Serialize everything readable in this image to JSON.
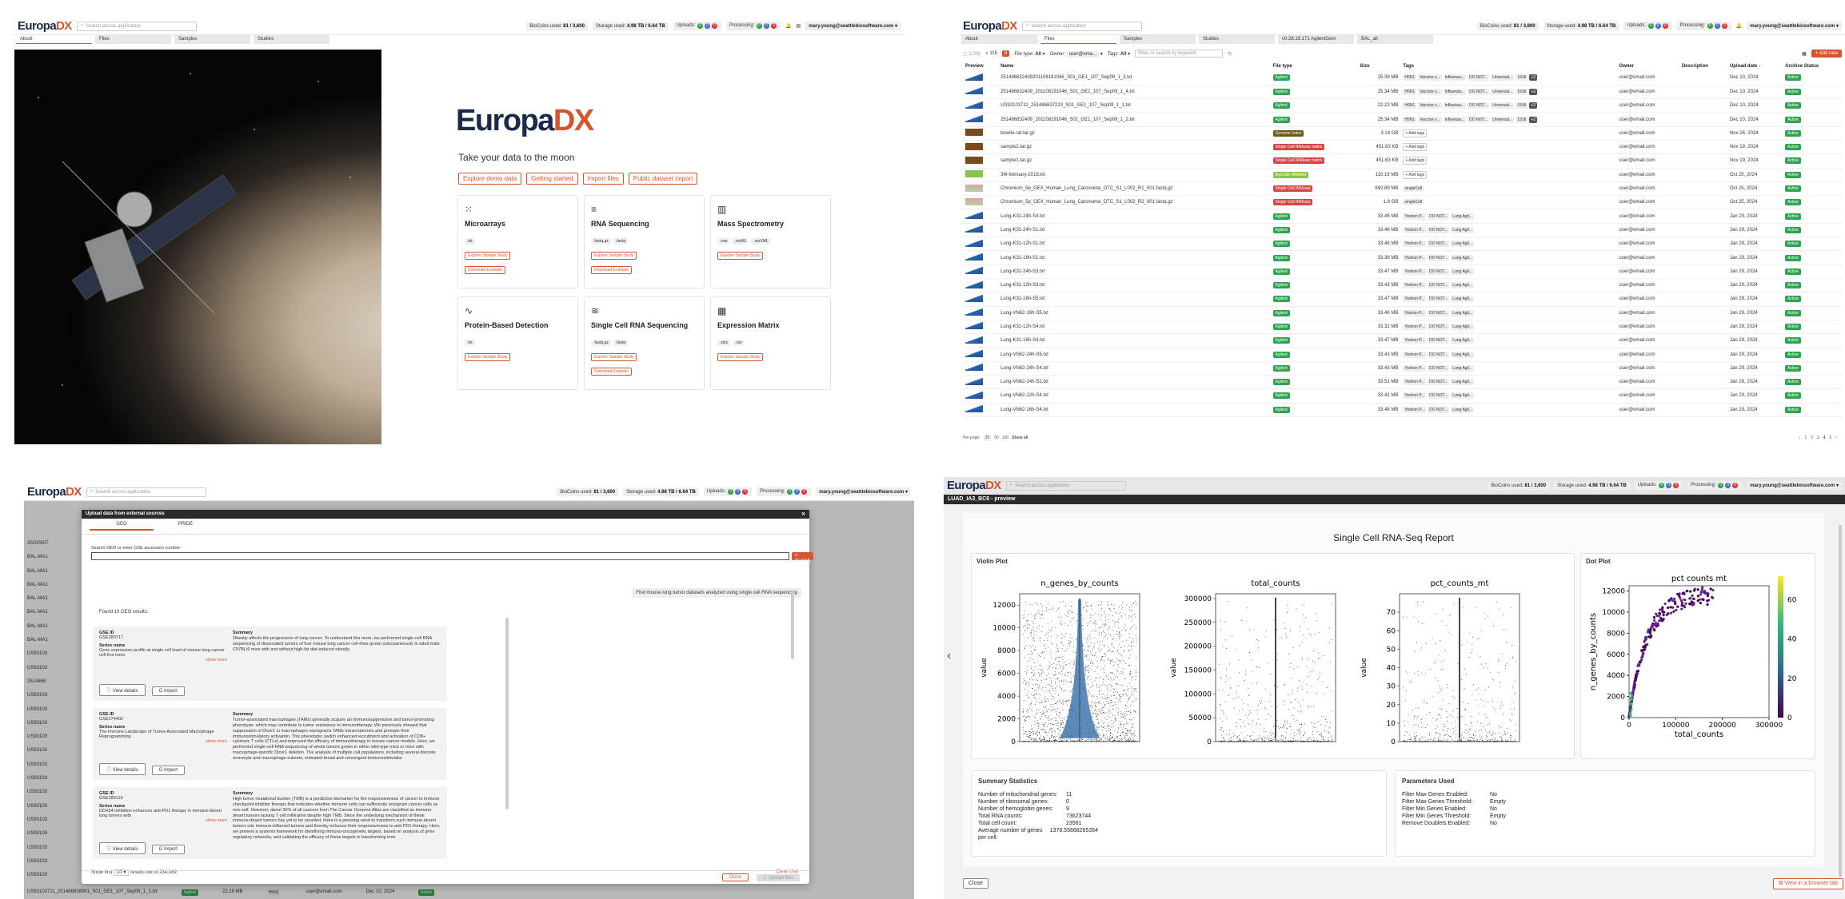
{
  "app": {
    "logo_main": "Europa",
    "logo_accent": "DX",
    "search_placeholder": "Search across application",
    "biocoins_label": "BioCoins used:",
    "biocoins": "81 / 3,600",
    "storage_label": "Storage used:",
    "storage": "4.98 TB / 6.64 TB",
    "uploads_label": "Uploads:",
    "processing_label": "Processing:",
    "counts": [
      "0",
      "0",
      "0"
    ],
    "user": "mary.young@seattlebiosoftware.com"
  },
  "colors": {
    "accent": "#d4562f",
    "brand": "#1a2a4a",
    "active": "#2ea44f"
  },
  "about": {
    "tabs": [
      "About",
      "Files",
      "Samples",
      "Studies"
    ],
    "logo_big_main": "Europa",
    "logo_big_accent": "DX",
    "tagline": "Take your data to the moon",
    "actions": [
      "Explore demo data",
      "Getting started",
      "Import files",
      "Public dataset import"
    ],
    "cards": [
      {
        "title": "Microarrays",
        "ext": [
          ".txt"
        ],
        "links": [
          "Explore Sample Study",
          "Download Example"
        ],
        "icon": "grid-icon"
      },
      {
        "title": "RNA Sequencing",
        "ext": [
          ".fastq.gz",
          ".fastq"
        ],
        "links": [
          "Explore Sample Study",
          "Download Example"
        ],
        "icon": "bars-icon"
      },
      {
        "title": "Mass Spectrometry",
        "ext": [
          ".raw",
          ".mzML",
          ".mzXML"
        ],
        "links": [
          "Explore Sample Study"
        ],
        "icon": "spectrum-icon"
      },
      {
        "title": "Protein-Based Detection",
        "ext": [
          ".txt"
        ],
        "links": [
          "Explore Sample Study"
        ],
        "icon": "wave-icon"
      },
      {
        "title": "Single Cell RNA Sequencing",
        "ext": [
          ".fastq.gz",
          ".fastq"
        ],
        "links": [
          "Explore Sample Study",
          "Download Example"
        ],
        "icon": "layers-icon"
      },
      {
        "title": "Expression Matrix",
        "ext": [
          ".xlsx",
          ".csv"
        ],
        "links": [
          "Explore Sample Study"
        ],
        "icon": "matrix-icon"
      }
    ]
  },
  "files": {
    "tabs": [
      "About",
      "Files",
      "Samples",
      "Studies",
      "v0.28.19.171 AgilentGem",
      "BAL_all"
    ],
    "count_all": "1,008",
    "count_filtered": "115",
    "count_flag": "8",
    "filetype_label": "File type:",
    "filetype_value": "All",
    "owner_label": "Owner:",
    "owner_value": "user@ema...",
    "tags_label": "Tags:",
    "tags_value": "All",
    "keyword_placeholder": "Filter or search by keyword",
    "add_new": "+ Add new",
    "columns": [
      "Preview",
      "Name",
      "File type",
      "Size",
      "Tags",
      "Owner",
      "Description",
      "Upload date ↓",
      "Archive Status"
    ],
    "rows": [
      [
        "2514868324092011081910​46_S01_GE1_107_Sep09_1_3.txt",
        "Agilent",
        "25.39 MB",
        "Dec 10, 2024"
      ],
      [
        "251486832409_201108191046_S01_GE1_107_Sep09_1_4.txt",
        "Agilent",
        "25.34 MB",
        "Dec 10, 2024"
      ],
      [
        "US93103711_251486837223_S01_GE1_107_Sep09_1_1.txt",
        "Agilent",
        "22.23 MB",
        "Dec 10, 2024"
      ],
      [
        "251486832409_201108191046_S01_GE1_107_Sep09_1_2.txt",
        "Agilent",
        "25.34 MB",
        "Dec 10, 2024"
      ],
      [
        "bowtie-rat.tar.gz",
        "Genome Index",
        "3.14 GB",
        "Nov 26, 2024"
      ],
      [
        "sample2.tar.gz",
        "Single Cell RNAseq matrix",
        "451.63 KB",
        "Nov 19, 2024"
      ],
      [
        "sample1.tar.gz",
        "Single Cell RNAseq matrix",
        "451.63 KB",
        "Nov 19, 2024"
      ],
      [
        "3M-february-2018.txt",
        "Barcode Whitelist",
        "110.16 MB",
        "Oct 25, 2024"
      ],
      [
        "Chromium_5p_GEX_Human_Lung_Carcinoma_DTC_S1_L002_R1_001.fastq.gz",
        "Single Cell RNAseq",
        "692.89 MB",
        "Oct 25, 2024"
      ],
      [
        "Chromium_5p_GEX_Human_Lung_Carcinoma_DTC_S1_L002_R2_001.fastq.gz",
        "Single Cell RNAseq",
        "1.6 GB",
        "Oct 25, 2024"
      ],
      [
        "Lung-K31-24h-S4.txt",
        "Agilent",
        "33.46 MB",
        "Jan 29, 2024"
      ],
      [
        "Lung-K31-24h-S1.txt",
        "Agilent",
        "33.46 MB",
        "Jan 29, 2024"
      ],
      [
        "Lung-K31-12h-S1.txt",
        "Agilent",
        "33.46 MB",
        "Jan 29, 2024"
      ],
      [
        "Lung-K31-16h-S1.txt",
        "Agilent",
        "33.38 MB",
        "Jan 29, 2024"
      ],
      [
        "Lung-K31-24h-S3.txt",
        "Agilent",
        "33.47 MB",
        "Jan 29, 2024"
      ],
      [
        "Lung-K31-12h-S3.txt",
        "Agilent",
        "33.43 MB",
        "Jan 29, 2024"
      ],
      [
        "Lung-K31-16h-S5.txt",
        "Agilent",
        "33.47 MB",
        "Jan 29, 2024"
      ],
      [
        "Lung-VN62-16h-S5.txt",
        "Agilent",
        "33.46 MB",
        "Jan 29, 2024"
      ],
      [
        "Lung-K31-12h-S4.txt",
        "Agilent",
        "33.32 MB",
        "Jan 29, 2024"
      ],
      [
        "Lung-K31-16h-S4.txt",
        "Agilent",
        "33.47 MB",
        "Jan 29, 2024"
      ],
      [
        "Lung-VN62-24h-S5.txt",
        "Agilent",
        "33.43 MB",
        "Jan 29, 2024"
      ],
      [
        "Lung-VN62-24h-S4.txt",
        "Agilent",
        "33.43 MB",
        "Jan 29, 2024"
      ],
      [
        "Lung-VN62-24h-S2.txt",
        "Agilent",
        "33.51 MB",
        "Jan 29, 2024"
      ],
      [
        "Lung-VN62-12h-S4.txt",
        "Agilent",
        "33.41 MB",
        "Jan 29, 2024"
      ],
      [
        "Lung-VN62-16h-S4.txt",
        "Agilent",
        "33.48 MB",
        "Jan 29, 2024"
      ]
    ],
    "owner": "user@email.com",
    "archive": "Active",
    "add_tags": "+ Add tags",
    "tag_singlecell": "singleCell",
    "agilent_tags": [
      "Yoshon P...",
      "DO NOT...",
      "Lung Agil..."
    ],
    "h1_tags": [
      "H5N1",
      "Vaccine s...",
      "Influenza...",
      "DO NOT...",
      "Universal...",
      "1918",
      "+2"
    ],
    "per_page_label": "Per page:",
    "per_page": [
      "25",
      "50",
      "100",
      "Show all"
    ],
    "pages": [
      "‹",
      "1",
      "2",
      "3",
      "4",
      "5",
      "›"
    ]
  },
  "geo": {
    "title": "Upload data from external sources",
    "tabs": [
      "GEO",
      "PRIDE"
    ],
    "input_label": "Search GEO or enter GSE accession number:",
    "search_btn": "Search",
    "chat_query": "Find mouse lung tumor datasets analyzed using single cell RNA sequencing",
    "found": "Found 10 GEO results:",
    "id_label": "GSE ID",
    "series_label": "Series name",
    "summary_label": "Summary",
    "view_btn": "View details",
    "import_btn": "Import",
    "show_more": "show more",
    "results": [
      {
        "id": "GSE280717",
        "series": "Gene expression profile at single cell level of mouse lung cancer cell-line tumo",
        "summary": "Obesity affects the progression of lung cancer. To understand this more, we performed single-cell RNA sequencing of dissociated tumors of four mouse lung cancer cell-lines grown subcutaneously in adult male C57BL/6 mice with and without high-fat diet-induced obesity."
      },
      {
        "id": "GSE274402",
        "series": "The Immune Landscape of Tumor-Associated Macrophage Reprogramming.",
        "summary": "Tumor-associated macrophages (TAMs) generally acquire an immunosuppressive and tumor-promoting phenotype, which may contribute to tumor resistance to immunotherapy. We previously showed that suppression of Dicer1 in macrophages reprograms TAMs transcriptomes and prompts their immunostimulatory activation. This phenotypic switch enhanced recruitment and activation of CD8+ cytotoxic T cells (CTLs) and improved the efficacy of immunotherapy in mouse cancer models. Here, we performed single-cell RNA sequencing of whole tumors grown in either wild-type mice or mice with macrophage-specific Dicer1 deletion. The analysis of multiple cell populations, including several discrete monocyte and macrophage subsets, indicated broad and convergent immunostimulator"
      },
      {
        "id": "GSE289119",
        "series": "DDX54 inhibition enhances anti-PD1 therapy in immune-desert lung tumors with",
        "summary": "High tumor mutational burden (TMB) is a predictive biomarker for the responsiveness of cancer to immune checkpoint inhibitor therapy that indicates whether immune cells can sufficiently recognize cancer cells as non-self. However, about 30% of all cancers from The Cancer Genome Atlas are classified as immune-desert tumors lacking T cell infiltration despite high TMB. Since the underlying mechanism of these immune-desert tumors has yet to be unveiled, there is a pressing need to transform such immune-desert tumors into immune-inflamed tumors and thereby enhance their responsiveness to anti-PD1 therapy. Here, we present a systems framework for identifying immuno-oncogenetic targets, based on analysis of gene regulatory networks, and validating the efficacy of these targets in transforming imm"
      }
    ],
    "show_first": "Show first",
    "show_value": "10",
    "results_of": "results out of 234,089",
    "clear_chat": "Clear chat",
    "close_btn": "Close",
    "upload_btn": "Upload files",
    "bg_rows": [
      "20200507",
      "BAL-MA1",
      "BAL-MA1",
      "BAL-MA1",
      "BAL-MA1",
      "BAL-MA1",
      "BAL-MA1",
      "BAL-MA1",
      "US93103",
      "US93103",
      "2514868",
      "US93103",
      "US93103",
      "US93103",
      "US93103",
      "US93103",
      "US93103",
      "US93103",
      "US93103",
      "US93103",
      "US93103",
      "US93103",
      "US93103",
      "US93103",
      "US93103"
    ],
    "bg_last_row": [
      "US93103711_251486838061_S01_GE1_107_Sep09_1_2.txt",
      "Agilent",
      "22.19 MB",
      "H5N1",
      "user@email.com",
      "Dec 10, 2024",
      "Active"
    ]
  },
  "preview": {
    "tab": "LUAD_IA3_BC6 - preview",
    "report_title": "Single Cell RNA-Seq Report",
    "violin_title": "Violin Plot",
    "dot_title": "Dot Plot",
    "stats_title": "Summary Statistics",
    "stats": [
      [
        "Number of mitochondrial genes:",
        "11"
      ],
      [
        "Number of ribosomal genes:",
        "0"
      ],
      [
        "Number of hemoglobin genes:",
        "9"
      ],
      [
        "Total RNA counts:",
        "73623744"
      ],
      [
        "Total cell count:",
        "23561"
      ],
      [
        "Average number of genes per cell:",
        "1378.55668265354"
      ]
    ],
    "params_title": "Parameters Used",
    "params": [
      [
        "Filter Max Genes Enabled:",
        "No"
      ],
      [
        "Filter Max Genes Threshold:",
        "Empty"
      ],
      [
        "Filter Min Genes Enabled:",
        "No"
      ],
      [
        "Filter Min Genes Threshold:",
        "Empty"
      ],
      [
        "Remove Doublets Enabled:",
        "No"
      ]
    ],
    "close_btn": "Close",
    "browser_btn": "View in a browser tab"
  },
  "chart_data": [
    {
      "type": "violin",
      "title": "n_genes_by_counts",
      "ylabel": "value",
      "ylim": [
        0,
        13000
      ],
      "yticks": [
        0,
        2000,
        4000,
        6000,
        8000,
        10000,
        12000
      ]
    },
    {
      "type": "violin",
      "title": "total_counts",
      "ylabel": "value",
      "ylim": [
        0,
        310000
      ],
      "yticks": [
        0,
        50000,
        100000,
        150000,
        200000,
        250000,
        300000
      ]
    },
    {
      "type": "violin",
      "title": "pct_counts_mt",
      "ylabel": "value",
      "ylim": [
        0,
        80
      ],
      "yticks": [
        0,
        10,
        20,
        30,
        40,
        50,
        60,
        70
      ]
    },
    {
      "type": "scatter",
      "title": "pct counts mt",
      "xlabel": "total_counts",
      "ylabel": "n_genes_by_counts",
      "xlim": [
        0,
        300000
      ],
      "ylim": [
        0,
        12500
      ],
      "xticks": [
        0,
        100000,
        200000,
        300000
      ],
      "yticks": [
        0,
        2000,
        4000,
        6000,
        8000,
        10000,
        12000
      ],
      "colorbar_ticks": [
        0,
        20,
        40,
        60
      ]
    }
  ]
}
